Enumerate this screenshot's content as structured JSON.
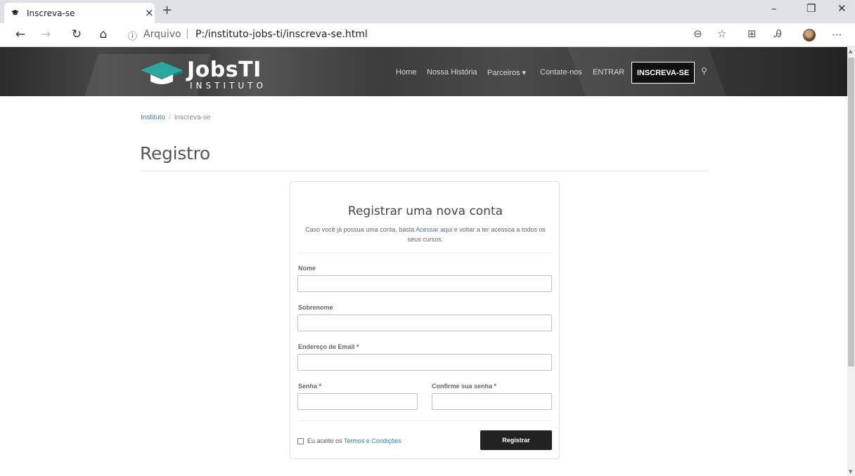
{
  "browser": {
    "tab_title": "Inscreva-se",
    "tab_close": "×",
    "new_tab": "+",
    "window_controls": {
      "minimize": "–",
      "restore": "❐",
      "close": "✕"
    },
    "nav": {
      "back": "←",
      "forward": "→",
      "refresh": "↻",
      "home": "⌂"
    },
    "address": {
      "info_icon": "ⓘ",
      "scheme_label": "Arquivo",
      "separator": "|",
      "url": "P:/instituto-jobs-ti/inscreva-se.html"
    },
    "toolbar_icons": [
      "zoom-out-icon",
      "favorite-star-icon",
      "collections-icon",
      "read-aloud-icon",
      "profile-avatar",
      "more-menu-icon"
    ],
    "toolbar_glyphs": {
      "zoom": "⊖",
      "star": "☆",
      "collections": "⊞",
      "read": "Ꭿ",
      "more": "···"
    }
  },
  "site": {
    "logo_title": "JobsTI",
    "logo_subtitle": "INSTITUTO",
    "nav": [
      "Home",
      "Nossa História",
      "Parceiros ▾",
      "Contate-nos",
      "ENTRAR"
    ],
    "cta": "INSCREVA-SE",
    "search_icon": "search-icon",
    "search_glyph": "⚲",
    "brand_color": "#2aa8a0"
  },
  "breadcrumb": {
    "root": "Instituto",
    "separator": "/",
    "current": "Inscreva-se"
  },
  "page_title": "Registro",
  "form": {
    "title": "Registrar uma nova conta",
    "desc_before": "Caso você já possua uma conta, basta ",
    "desc_link": "Acessar aqui",
    "desc_after": " e voltar a ter acessoa a todos os seus cursos.",
    "fields": {
      "nome": {
        "label": "Nome",
        "value": ""
      },
      "sobrenome": {
        "label": "Sobrenome",
        "value": ""
      },
      "email": {
        "label": "Endereço de Email *",
        "value": ""
      },
      "senha": {
        "label": "Senha *",
        "value": ""
      },
      "confirma": {
        "label": "Confirme sua senha *",
        "value": ""
      }
    },
    "terms_before": "Eu aceito os ",
    "terms_link": "Termos e Condições",
    "terms_checked": false,
    "submit": "Registrar"
  }
}
